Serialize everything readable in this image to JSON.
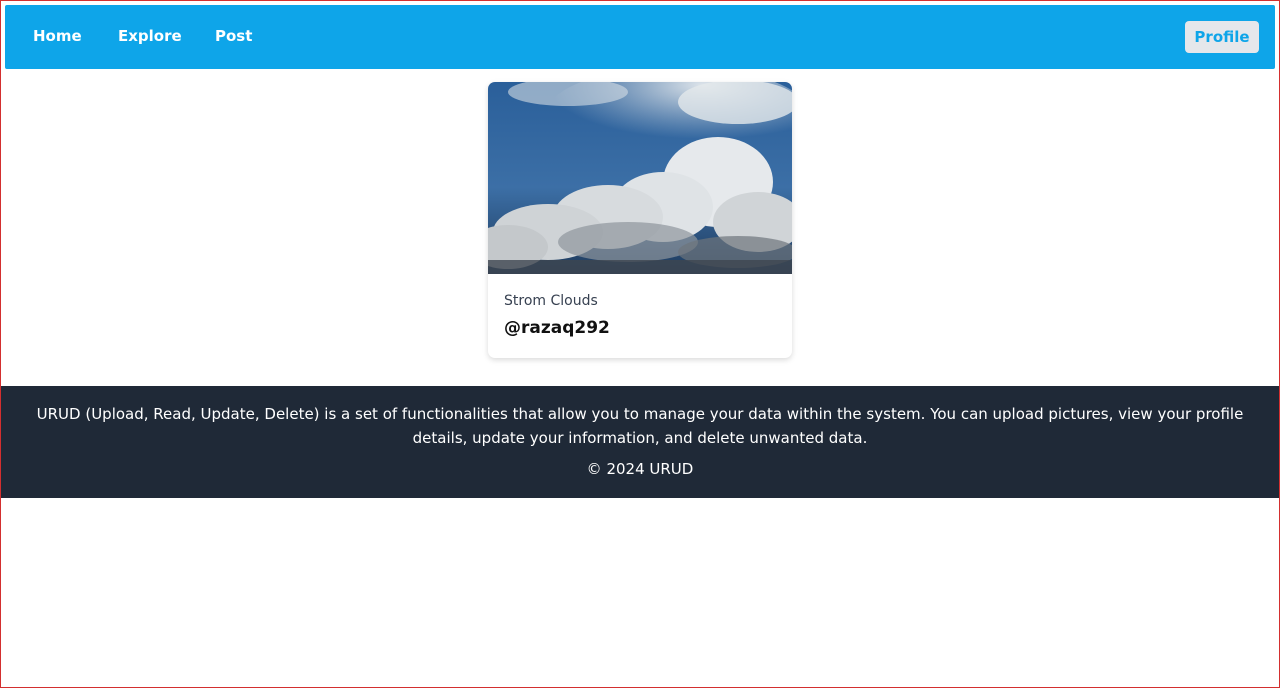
{
  "nav": {
    "links": [
      "Home",
      "Explore",
      "Post"
    ],
    "profile_label": "Profile"
  },
  "card": {
    "image_alt": "clouds-photo",
    "title": "Strom Clouds",
    "user": "@razaq292"
  },
  "footer": {
    "description": "URUD (Upload, Read, Update, Delete) is a set of functionalities that allow you to manage your data within the system. You can upload pictures, view your profile details, update your information, and delete unwanted data.",
    "copyright": "© 2024 URUD"
  },
  "colors": {
    "accent": "#0ea5e9",
    "footer_bg": "#1f2937"
  }
}
